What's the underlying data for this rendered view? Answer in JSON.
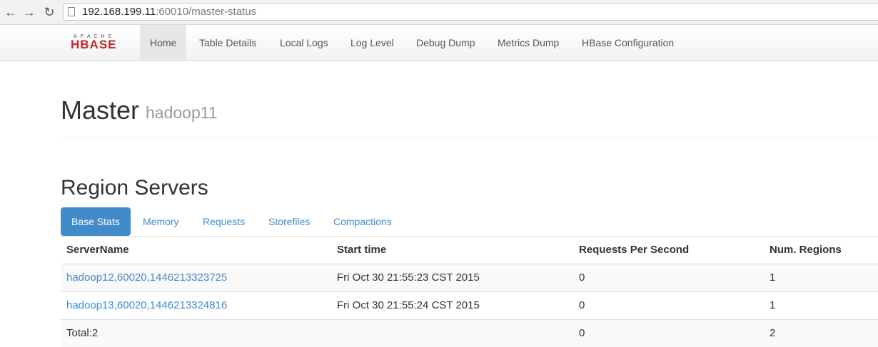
{
  "browser": {
    "back_icon": "arrow-left-icon",
    "forward_icon": "arrow-right-icon",
    "reload_icon": "reload-icon",
    "url_host": "192.168.199.11",
    "url_rest": ":60010/master-status"
  },
  "logo": {
    "top": "APACHE",
    "main": "HBASE"
  },
  "nav": {
    "home": "Home",
    "table_details": "Table Details",
    "local_logs": "Local Logs",
    "log_level": "Log Level",
    "debug_dump": "Debug Dump",
    "metrics_dump": "Metrics Dump",
    "hbase_config": "HBase Configuration"
  },
  "page": {
    "title": "Master",
    "subtitle": "hadoop11"
  },
  "region_servers": {
    "title": "Region Servers",
    "tabs": [
      "Base Stats",
      "Memory",
      "Requests",
      "Storefiles",
      "Compactions"
    ],
    "headers": [
      "ServerName",
      "Start time",
      "Requests Per Second",
      "Num. Regions"
    ],
    "rows": [
      [
        "hadoop12,60020,1446213323725",
        "Fri Oct 30 21:55:23 CST 2015",
        "0",
        "1"
      ],
      [
        "hadoop13,60020,1446213324816",
        "Fri Oct 30 21:55:24 CST 2015",
        "0",
        "1"
      ]
    ],
    "total": [
      "Total:2",
      "",
      "0",
      "2"
    ]
  },
  "colors": {
    "accent": "#428bca",
    "logo_red": "#c1272d"
  }
}
